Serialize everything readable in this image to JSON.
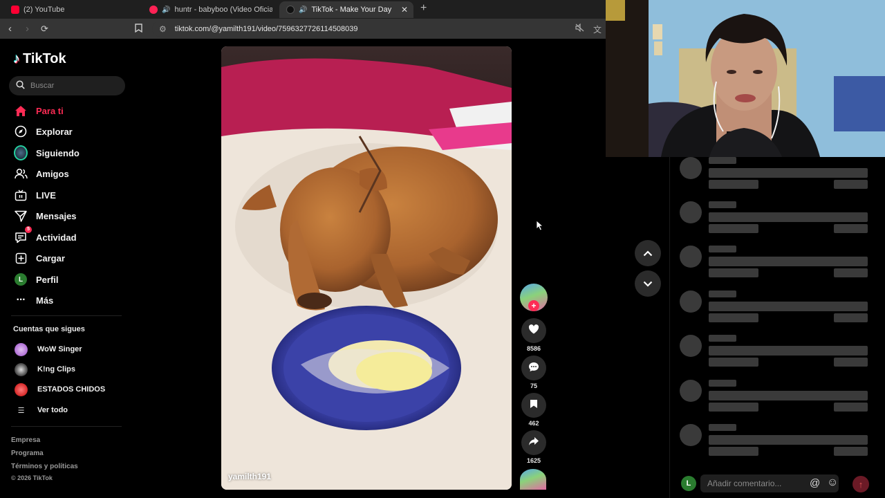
{
  "browser": {
    "tabs": [
      {
        "title": "(2) YouTube",
        "fav_color": "#ff0033"
      },
      {
        "title": "huntr - babyboo (Video Oficial) |",
        "fav_color": "#ff2255"
      },
      {
        "title": "TikTok - Make Your Day",
        "fav_color": "#111111"
      }
    ],
    "url": "tiktok.com/@yamilth191/video/7596327726114508039"
  },
  "sidebar": {
    "brand": "TikTok",
    "search_placeholder": "Buscar",
    "menu": [
      {
        "label": "Para ti",
        "icon": "home-icon",
        "active": true
      },
      {
        "label": "Explorar",
        "icon": "compass-icon"
      },
      {
        "label": "Siguiendo",
        "icon": "following-avatar-icon"
      },
      {
        "label": "Amigos",
        "icon": "friends-icon"
      },
      {
        "label": "LIVE",
        "icon": "live-icon"
      },
      {
        "label": "Mensajes",
        "icon": "send-icon"
      },
      {
        "label": "Actividad",
        "icon": "activity-icon",
        "badge": "5"
      },
      {
        "label": "Cargar",
        "icon": "upload-icon"
      },
      {
        "label": "Perfil",
        "icon": "profile-avatar-icon",
        "avatar_letter": "L"
      },
      {
        "label": "Más",
        "icon": "more-icon"
      }
    ],
    "following_title": "Cuentas que sigues",
    "following": [
      {
        "name": "WoW Singer",
        "color": "#b06ed6"
      },
      {
        "name": "K!ng Clips",
        "color": "#555555"
      },
      {
        "name": "ESTADOS CHIDOS",
        "color": "#d62828"
      }
    ],
    "see_all": "Ver todo",
    "footer": [
      "Empresa",
      "Programa",
      "Términos y políticas"
    ],
    "copyright": "© 2026 TikTok"
  },
  "video": {
    "author": "yamilth191"
  },
  "actions": {
    "likes": "8586",
    "comments": "75",
    "saves": "462",
    "shares": "1625"
  },
  "comments_panel": {
    "placeholder": "Añadir comentario...",
    "user_initial": "L"
  }
}
